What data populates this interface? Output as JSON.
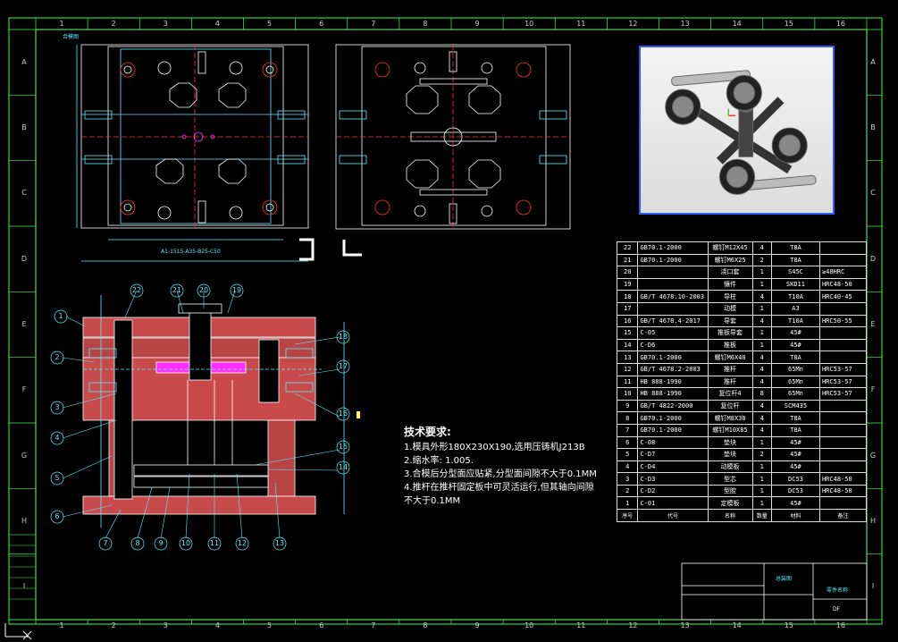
{
  "sheet": {
    "name": "合模图",
    "cols": [
      "1",
      "2",
      "3",
      "4",
      "5",
      "6",
      "7",
      "8",
      "9",
      "10",
      "11",
      "12",
      "13",
      "14",
      "15",
      "16"
    ],
    "rows": [
      "A",
      "B",
      "C",
      "D",
      "E",
      "F",
      "G",
      "H",
      "I"
    ],
    "dim_label": "A1-1515-A35-B25-C50"
  },
  "notes": {
    "title": "技术要求:",
    "lines": [
      "1.模具外形180X230X190,选用压铸机J213B",
      "2.缩水率: 1.005.",
      "3.合模后分型面应贴紧,分型面间隙不大于0.1MM",
      "4.推杆在推杆固定板中可灵活运行,但其轴向间隙",
      "不大于0.1MM"
    ]
  },
  "callouts": [
    "1",
    "2",
    "3",
    "4",
    "5",
    "6",
    "7",
    "8",
    "9",
    "10",
    "11",
    "12",
    "13",
    "14",
    "15",
    "16",
    "17",
    "18",
    "19",
    "20",
    "21",
    "22"
  ],
  "bom": [
    {
      "n": "22",
      "code": "GB70.1-2000",
      "name": "螺钉M12X45",
      "qty": "4",
      "mat": "T8A",
      "heat": ""
    },
    {
      "n": "21",
      "code": "GB70.1-2000",
      "name": "螺钉M6X25",
      "qty": "2",
      "mat": "T8A",
      "heat": ""
    },
    {
      "n": "20",
      "code": "",
      "name": "浇口套",
      "qty": "1",
      "mat": "S45C",
      "heat": "≥48HRC"
    },
    {
      "n": "19",
      "code": "",
      "name": "镶件",
      "qty": "1",
      "mat": "SKD11",
      "heat": "HRC48-50"
    },
    {
      "n": "18",
      "code": "GB/T 4678.10-2003",
      "name": "导柱",
      "qty": "4",
      "mat": "T10A",
      "heat": "HRC40-45"
    },
    {
      "n": "17",
      "code": "",
      "name": "动模",
      "qty": "1",
      "mat": "A3",
      "heat": ""
    },
    {
      "n": "16",
      "code": "GB/T 4678.4-2017",
      "name": "导套",
      "qty": "4",
      "mat": "T10A",
      "heat": "HRC50-55"
    },
    {
      "n": "15",
      "code": "C-05",
      "name": "推板导套",
      "qty": "1",
      "mat": "45#",
      "heat": ""
    },
    {
      "n": "14",
      "code": "C-D6",
      "name": "推板",
      "qty": "1",
      "mat": "45#",
      "heat": ""
    },
    {
      "n": "13",
      "code": "GB70.1-2000",
      "name": "螺钉M6X40",
      "qty": "4",
      "mat": "T8A",
      "heat": ""
    },
    {
      "n": "12",
      "code": "GB/T 4678.2-2003",
      "name": "推杆",
      "qty": "4",
      "mat": "65Mn",
      "heat": "HRC53-57"
    },
    {
      "n": "11",
      "code": "HB 888-1990",
      "name": "推杆",
      "qty": "4",
      "mat": "65Mn",
      "heat": "HRC53-57"
    },
    {
      "n": "10",
      "code": "HB 888-1990",
      "name": "复位杆4",
      "qty": "8",
      "mat": "65Mn",
      "heat": "HRC53-57"
    },
    {
      "n": "9",
      "code": "GB/T 4822-2000",
      "name": "复位杆",
      "qty": "4",
      "mat": "SCM435",
      "heat": ""
    },
    {
      "n": "8",
      "code": "GB70.1-2000",
      "name": "螺钉M8X30",
      "qty": "4",
      "mat": "T8A",
      "heat": ""
    },
    {
      "n": "7",
      "code": "GB70.1-2000",
      "name": "螺钉M10X85",
      "qty": "4",
      "mat": "T8A",
      "heat": ""
    },
    {
      "n": "6",
      "code": "C-08",
      "name": "垫块",
      "qty": "1",
      "mat": "45#",
      "heat": ""
    },
    {
      "n": "5",
      "code": "C-D7",
      "name": "垫块",
      "qty": "2",
      "mat": "45#",
      "heat": ""
    },
    {
      "n": "4",
      "code": "C-D4",
      "name": "动模板",
      "qty": "1",
      "mat": "45#",
      "heat": ""
    },
    {
      "n": "3",
      "code": "C-D3",
      "name": "型芯",
      "qty": "1",
      "mat": "DC53",
      "heat": "HRC48-50"
    },
    {
      "n": "2",
      "code": "C-D2",
      "name": "型腔",
      "qty": "1",
      "mat": "DC53",
      "heat": "HRC48-50"
    },
    {
      "n": "1",
      "code": "C-01",
      "name": "定模板",
      "qty": "1",
      "mat": "45#",
      "heat": ""
    }
  ],
  "bom_header": {
    "n": "序号",
    "code": "代号",
    "name": "名称",
    "qty": "数量",
    "mat": "材料",
    "heat": "备注"
  },
  "title_block": {
    "drawing": "总装图",
    "part": "零件名称",
    "code": "DF"
  },
  "colors": {
    "cyan": "#55eeff",
    "red": "#ff3030",
    "magenta": "#ff30ff",
    "green": "#3aff3a",
    "yellow": "#ffff40",
    "hatch": "#d04040",
    "border": "#2a5cff"
  }
}
